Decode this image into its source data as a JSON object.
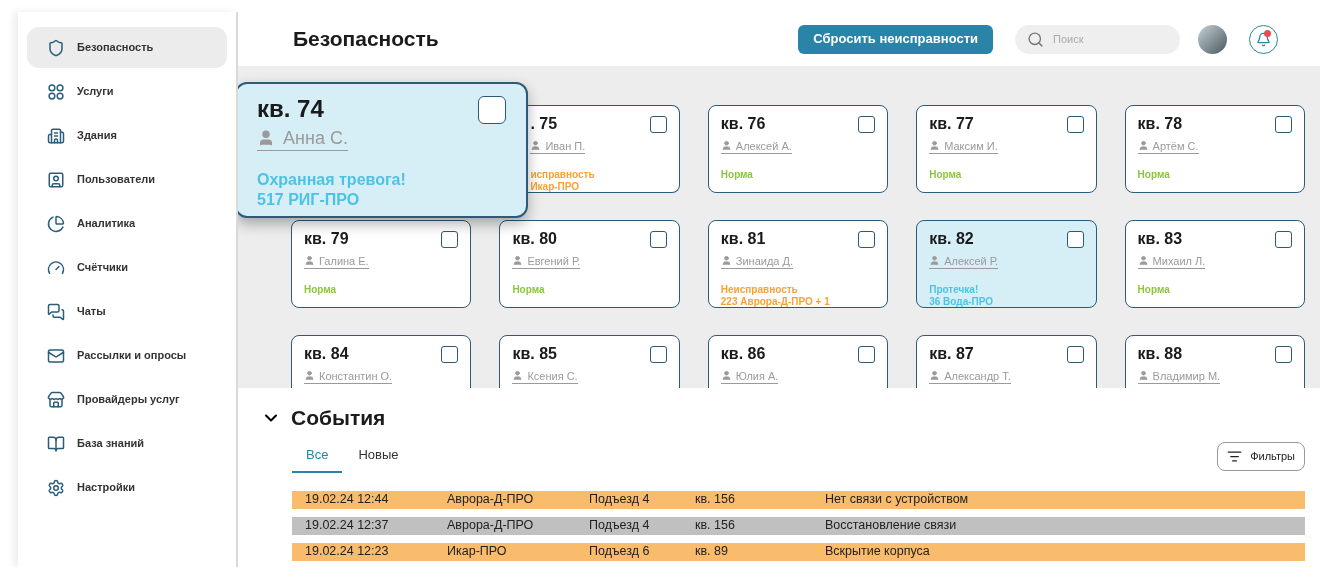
{
  "sidebar": {
    "items": [
      {
        "label": "Безопасность",
        "selected": true
      },
      {
        "label": "Услуги",
        "selected": false
      },
      {
        "label": "Здания",
        "selected": false
      },
      {
        "label": "Пользователи",
        "selected": false
      },
      {
        "label": "Аналитика",
        "selected": false
      },
      {
        "label": "Счётчики",
        "selected": false
      },
      {
        "label": "Чаты",
        "selected": false
      },
      {
        "label": "Рассылки и опросы",
        "selected": false
      },
      {
        "label": "Провайдеры услуг",
        "selected": false
      },
      {
        "label": "База знаний",
        "selected": false
      },
      {
        "label": "Настройки",
        "selected": false
      }
    ]
  },
  "header": {
    "title": "Безопасность",
    "reset_button": "Сбросить неисправности",
    "search": {
      "placeholder": "Поиск"
    },
    "notifications_unread": true
  },
  "apartments": [
    {
      "title": "кв. 74",
      "resident": "Анна С.",
      "kind": "alarm",
      "status": [
        "Охранная тревога!",
        "517 РИГ-ПРО"
      ],
      "checked": false,
      "expanded": true
    },
    {
      "title": ". 75",
      "resident": "Иван П.",
      "kind": "fault",
      "status": [
        "исправность",
        "Икар-ПРО"
      ],
      "checked": false,
      "expanded": false
    },
    {
      "title": "кв. 76",
      "resident": "Алексей А.",
      "kind": "norm",
      "status": [
        "Норма"
      ],
      "checked": false,
      "expanded": false
    },
    {
      "title": "кв. 77",
      "resident": "Максим И.",
      "kind": "norm",
      "status": [
        "Норма"
      ],
      "checked": false,
      "expanded": false
    },
    {
      "title": "кв. 78",
      "resident": "Артём С.",
      "kind": "norm",
      "status": [
        "Норма"
      ],
      "checked": false,
      "expanded": false
    },
    {
      "title": "кв. 79",
      "resident": "Галина Е.",
      "kind": "norm",
      "status": [
        "Норма"
      ],
      "checked": false,
      "expanded": false
    },
    {
      "title": "кв. 80",
      "resident": "Евгений Р.",
      "kind": "norm",
      "status": [
        "Норма"
      ],
      "checked": false,
      "expanded": false
    },
    {
      "title": "кв. 81",
      "resident": "Зинаида Д.",
      "kind": "fault",
      "status": [
        "Неисправность",
        "223 Аврора-Д-ПРО + 1"
      ],
      "checked": false,
      "expanded": false
    },
    {
      "title": "кв. 82",
      "resident": "Алексей Р.",
      "kind": "alarm",
      "status": [
        "Протечка!",
        "36 Вода-ПРО"
      ],
      "checked": false,
      "expanded": false
    },
    {
      "title": "кв. 83",
      "resident": "Михаил Л.",
      "kind": "norm",
      "status": [
        "Норма"
      ],
      "checked": false,
      "expanded": false
    },
    {
      "title": "кв. 84",
      "resident": "Константин О.",
      "kind": "norm",
      "checked": false,
      "expanded": false
    },
    {
      "title": "кв. 85",
      "resident": "Ксения С.",
      "kind": "norm",
      "checked": false,
      "expanded": false
    },
    {
      "title": "кв. 86",
      "resident": "Юлия А.",
      "kind": "norm",
      "checked": false,
      "expanded": false
    },
    {
      "title": "кв. 87",
      "resident": "Александр Т.",
      "kind": "norm",
      "checked": false,
      "expanded": false
    },
    {
      "title": "кв. 88",
      "resident": "Владимир М.",
      "kind": "norm",
      "checked": false,
      "expanded": false
    }
  ],
  "events": {
    "title": "События",
    "expanded": true,
    "tabs": [
      {
        "label": "Все",
        "selected": true
      },
      {
        "label": "Новые",
        "selected": false
      }
    ],
    "filter_button": "Фильтры",
    "rows": [
      {
        "color": "#f9bb6c",
        "cells": [
          "19.02.24 12:44",
          "Аврора-Д-ПРО",
          "Подъезд 4",
          "кв. 156",
          "Нет связи с устройством"
        ]
      },
      {
        "color": "#c0c0c0",
        "cells": [
          "19.02.24 12:37",
          "Аврора-Д-ПРО",
          "Подъезд 4",
          "кв. 156",
          "Восстановление связи"
        ]
      },
      {
        "color": "#f9bb6c",
        "cells": [
          "19.02.24 12:23",
          "Икар-ПРО",
          "Подъезд 6",
          "кв. 89",
          "Вскрытие корпуса"
        ]
      }
    ]
  }
}
